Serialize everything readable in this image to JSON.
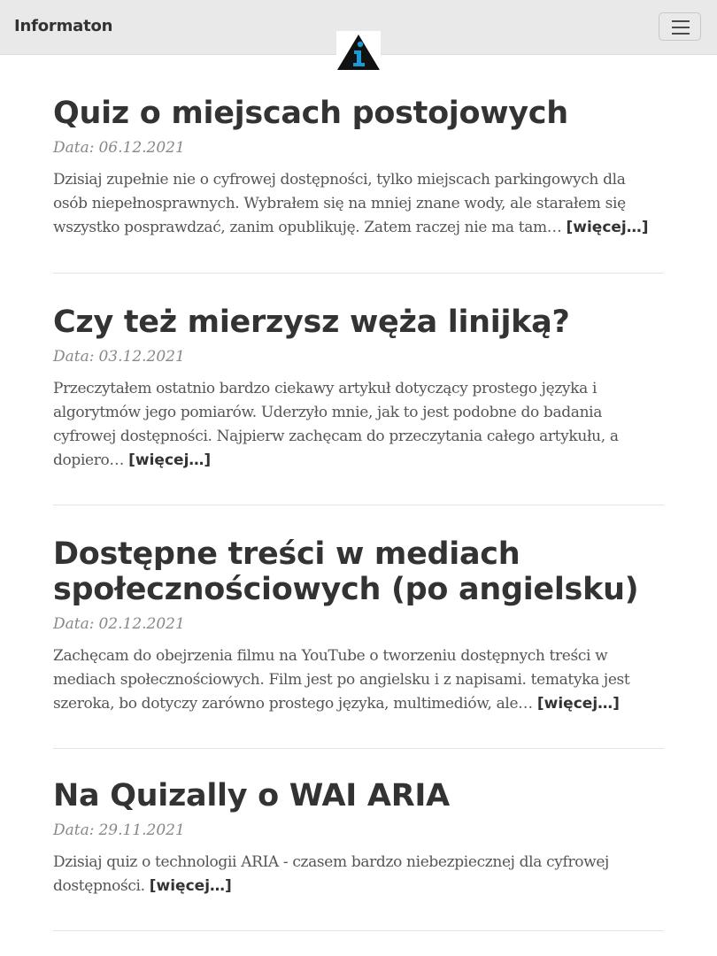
{
  "navbar": {
    "brand": "Informaton",
    "menu_icon": "hamburger-menu-icon",
    "logo_icon": "information-warning-logo"
  },
  "posts": [
    {
      "title": "Quiz o miejscach postojowych",
      "date_label": "Data:",
      "date": "06.12.2021",
      "excerpt": "Dzisiaj zupełnie nie o cyfrowej dostępności, tylko miejscach parkingowych dla osób niepełnosprawnych. Wybrałem się na mniej znane wody, ale starałem się wszystko posprawdzać, zanim opublikuję. Zatem raczej nie ma tam…",
      "more": "[więcej…]"
    },
    {
      "title": "Czy też mierzysz węża linijką?",
      "date_label": "Data:",
      "date": "03.12.2021",
      "excerpt": "Przeczytałem ostatnio bardzo ciekawy artykuł dotyczący prostego języka i algorytmów jego pomiarów. Uderzyło mnie, jak to jest podobne do badania cyfrowej dostępności. Najpierw zachęcam do przeczytania całego artykułu, a dopiero…",
      "more": "[więcej…]"
    },
    {
      "title": "Dostępne treści w mediach społecznościowych (po angielsku)",
      "date_label": "Data:",
      "date": "02.12.2021",
      "excerpt": "Zachęcam do obejrzenia filmu na YouTube o tworzeniu dostępnych treści w mediach społecznościowych. Film jest po angielsku i z napisami. tematyka jest szeroka, bo dotyczy zarówno prostego języka, multimediów, ale…",
      "more": "[więcej…]"
    },
    {
      "title": "Na Quizally o WAI ARIA",
      "date_label": "Data:",
      "date": "29.11.2021",
      "excerpt": "Dzisiaj quiz o technologii ARIA - czasem bardzo niebezpiecznej dla cyfrowej dostępności.",
      "more": "[więcej…]"
    }
  ],
  "colors": {
    "navbar_bg": "#e9e9e9",
    "title": "#333333",
    "date": "#888888",
    "text": "#555555",
    "logo_blue": "#1a9ad6"
  }
}
